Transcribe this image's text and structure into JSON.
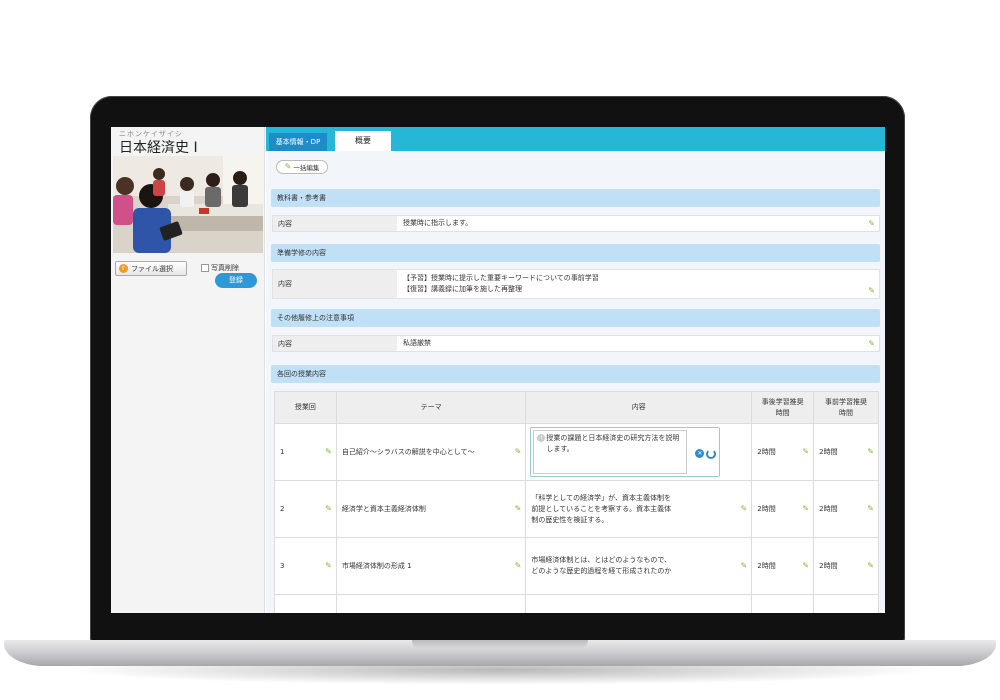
{
  "course": {
    "kana": "ニホンケイザイシ",
    "title": "日本経済史 Ⅰ",
    "file_button": "ファイル選択",
    "delete_photo": "写真削除",
    "register_button": "登録"
  },
  "tabs": {
    "basic": "基本情報・DP",
    "summary": "概要"
  },
  "toolbar": {
    "bulk_edit": "一括編集"
  },
  "sections": {
    "textbook": {
      "heading": "教科書・参考書",
      "label": "内容",
      "value": "授業時に指示します。"
    },
    "prep": {
      "heading": "準備学修の内容",
      "label": "内容",
      "lines": [
        "【予習】授業時に提示した重要キーワードについての事前学習",
        "【復習】講義録に加筆を施した再整理"
      ]
    },
    "notes": {
      "heading": "その他履修上の注意事項",
      "label": "内容",
      "value": "私語厳禁"
    },
    "lessons": {
      "heading": "各回の授業内容"
    }
  },
  "lesson_table": {
    "headers": {
      "no": "授業回",
      "theme": "テーマ",
      "content": "内容",
      "post": [
        "事後学習推奨",
        "時間"
      ],
      "pre": [
        "事前学習推奨",
        "時間"
      ]
    },
    "rows": [
      {
        "no": "1",
        "theme": "自己紹介～シラバスの解説を中心として～",
        "content": "授業の課題と日本経済史の研究方法を説明します。",
        "post": "2時間",
        "pre": "2時間"
      },
      {
        "no": "2",
        "theme": "経済学と資本主義経済体制",
        "content_lines": [
          "「科学としての経済学」が、資本主義体制を",
          "前提としていることを考察する。資本主義体",
          "制の歴史性を検証する。"
        ],
        "post": "2時間",
        "pre": "2時間"
      },
      {
        "no": "3",
        "theme": "市場経済体制の形成 1",
        "content_lines": [
          "市場経済体制とは、とはどのようなもので、",
          "どのような歴史的過程を経て形成されたのか"
        ],
        "post": "2時間",
        "pre": "2時間"
      }
    ]
  }
}
